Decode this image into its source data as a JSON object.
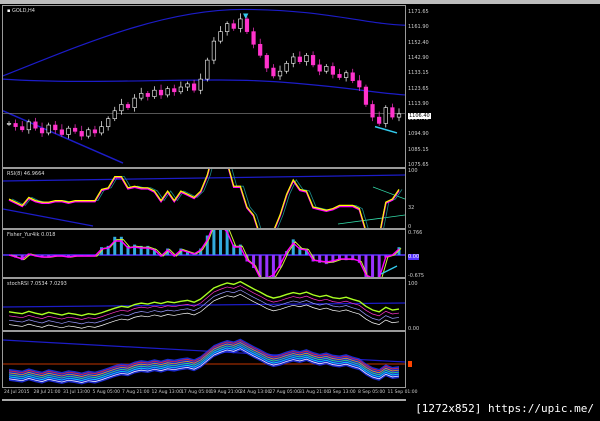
{
  "symbol_label": "GOLD,H4",
  "main_axis": [
    "1171.65",
    "1161.90",
    "1152.40",
    "1142.90",
    "1133.15",
    "1123.65",
    "1113.90",
    "1104.40",
    "1094.90",
    "1085.15",
    "1075.65"
  ],
  "current_price": "1106.40",
  "rsi": {
    "label": "RSI(8) 46.9664",
    "axis": [
      "100",
      "32",
      "0"
    ]
  },
  "fisher": {
    "label": "Fisher_Yur4ik 0.018",
    "axis": [
      "0.766",
      "0.00",
      "-0.675"
    ]
  },
  "stoch": {
    "label": "stochRSI 7.0534 7.0293",
    "axis": [
      "100",
      "0.00"
    ]
  },
  "time_labels": [
    "24 Jul 2015",
    "28 Jul 21:00",
    "31 Jul 13:00",
    "5 Aug 05:00",
    "7 Aug 21:00",
    "12 Aug 13:00",
    "17 Aug 05:00",
    "19 Aug 21:00",
    "24 Aug 13:00",
    "27 Aug 05:00",
    "31 Aug 21:00",
    "3 Sep 13:00",
    "8 Sep 05:00",
    "11 Sep 01:00"
  ],
  "watermark": "[1272x852] https://upic.me/",
  "price_closes": [
    1100,
    1098,
    1096,
    1101,
    1097,
    1094,
    1099,
    1096,
    1093,
    1097,
    1095,
    1092,
    1096,
    1094,
    1098,
    1103,
    1108,
    1112,
    1110,
    1116,
    1119,
    1117,
    1121,
    1118,
    1122,
    1120,
    1123,
    1125,
    1121,
    1128,
    1140,
    1152,
    1158,
    1163,
    1160,
    1166,
    1158,
    1150,
    1143,
    1135,
    1130,
    1133,
    1138,
    1142,
    1139,
    1143,
    1137,
    1133,
    1136,
    1131,
    1129,
    1132,
    1127,
    1123,
    1112,
    1104,
    1100,
    1110,
    1104,
    1106
  ],
  "colors": {
    "candle_up": "#ffffff",
    "candle_down": "#ff33cc",
    "channel": "#1c1cc8",
    "rsi": "#ffff00",
    "rsi_signal": "#ff00ff",
    "divergence_arrow": "#33ccee",
    "fisher_hist_up": "#33aadd",
    "fisher_hist_down": "#9933ff",
    "stoch_fast": "#aaff22",
    "zero_line": "#5533ff",
    "level_marker": "#ff4400"
  }
}
